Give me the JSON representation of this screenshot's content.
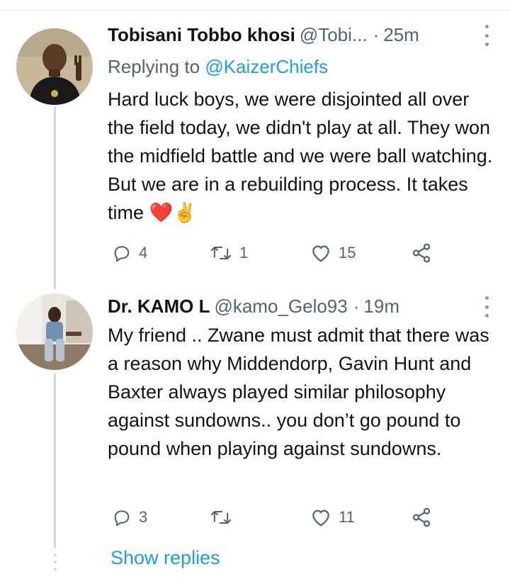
{
  "tweets": [
    {
      "display_name": "Tobisani Tobbo khosi",
      "handle": "@Tobi...",
      "separator": "·",
      "time": "25m",
      "replying_label": "Replying to",
      "replying_to": "@KaizerChiefs",
      "text": "Hard luck boys, we were disjointed all over the field today, we didn't play at all. They won the midfield battle and we were ball watching. But we are in a rebuilding process. It takes time",
      "emoji_heart": "❤️",
      "emoji_hand": "✌️",
      "replies": "4",
      "retweets": "1",
      "likes": "15"
    },
    {
      "display_name": "Dr. KAMO L",
      "handle": "@kamo_Gelo93",
      "separator": "·",
      "time": "19m",
      "text": "My friend .. Zwane must admit that there was a reason why Middendorp, Gavin Hunt and Baxter always played similar philosophy against sundowns.. you don’t go pound to pound when playing against sundowns.",
      "replies": "3",
      "retweets": "",
      "likes": "11"
    }
  ],
  "show_replies_label": "Show replies",
  "icons": {
    "reply": "reply-icon",
    "retweet": "retweet-icon",
    "like": "heart-icon",
    "share": "share-icon",
    "more": "more-icon"
  },
  "colors": {
    "link": "#1d9bf0",
    "secondary_text": "#536471",
    "thread_line": "#cfd9de"
  }
}
